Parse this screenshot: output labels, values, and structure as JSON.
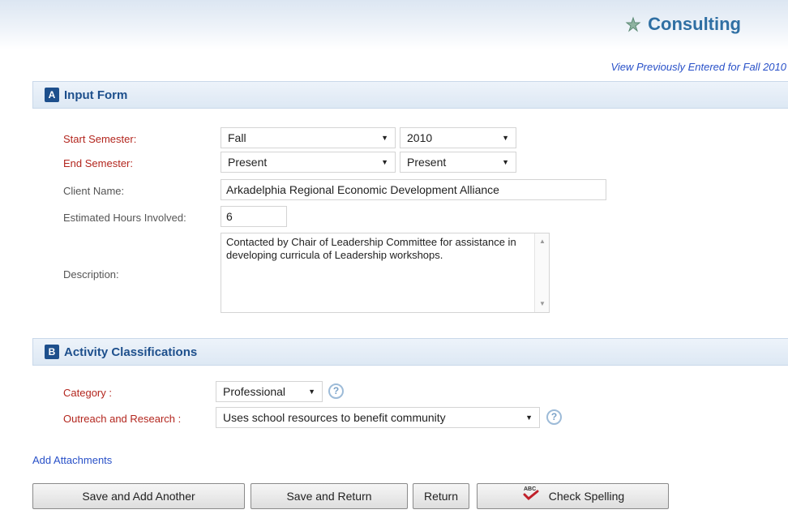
{
  "header": {
    "title": "Consulting",
    "view_link": "View Previously Entered for Fall 2010"
  },
  "section_a": {
    "badge": "A",
    "title": "Input Form"
  },
  "form": {
    "start_semester": {
      "label": "Start Semester:",
      "term": "Fall",
      "year": "2010"
    },
    "end_semester": {
      "label": "End Semester:",
      "term": "Present",
      "year": "Present"
    },
    "client_name": {
      "label": "Client Name:",
      "value": "Arkadelphia Regional Economic Development Alliance"
    },
    "hours": {
      "label": "Estimated Hours Involved:",
      "value": "6"
    },
    "description": {
      "label": "Description:",
      "value": "Contacted by Chair of Leadership Committee for assistance in developing curricula of Leadership workshops."
    }
  },
  "section_b": {
    "badge": "B",
    "title": "Activity Classifications"
  },
  "classification": {
    "category": {
      "label": "Category :",
      "value": "Professional"
    },
    "outreach": {
      "label": "Outreach and Research :",
      "value": "Uses school resources to benefit community"
    }
  },
  "add_attachments": "Add Attachments",
  "buttons": {
    "save_add": "Save and Add Another",
    "save_return": "Save and Return",
    "return": "Return",
    "check_spelling": "Check Spelling"
  },
  "icons": {
    "logo": "consulting-logo-icon",
    "help": "help-question-icon",
    "spellcheck": "spellcheck-icon",
    "dropdown": "chevron-down-icon"
  },
  "colors": {
    "accent": "#1d4f8c",
    "title": "#2f6fa3",
    "required_label": "#b3261e",
    "link": "#2850c8"
  }
}
